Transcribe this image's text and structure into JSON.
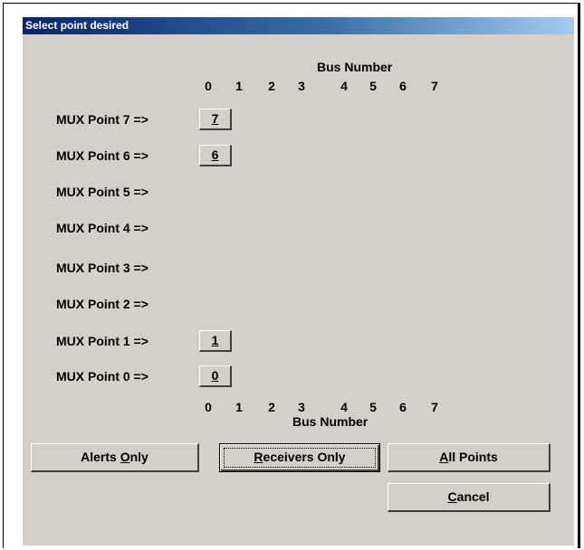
{
  "dialog": {
    "title": "Select point desired"
  },
  "bus_header_top": "Bus Number",
  "bus_header_bottom": "Bus Number",
  "bus_numbers": [
    "0",
    "1",
    "2",
    "3",
    "4",
    "5",
    "6",
    "7"
  ],
  "mux_rows": [
    {
      "label": "MUX Point 7 =>",
      "button": "7"
    },
    {
      "label": "MUX Point 6 =>",
      "button": "6"
    },
    {
      "label": "MUX Point 5 =>",
      "button": null
    },
    {
      "label": "MUX Point 4 =>",
      "button": null
    },
    {
      "label": "MUX Point 3 =>",
      "button": null
    },
    {
      "label": "MUX Point 2 =>",
      "button": null
    },
    {
      "label": "MUX Point 1 =>",
      "button": "1"
    },
    {
      "label": "MUX Point 0 =>",
      "button": "0"
    }
  ],
  "buttons": {
    "alerts_only": {
      "pre": "Alerts ",
      "accel": "O",
      "post": "nly"
    },
    "receivers_only": {
      "pre": "",
      "accel": "R",
      "post": "eceivers Only"
    },
    "all_points": {
      "pre": "",
      "accel": "A",
      "post": "ll Points"
    },
    "cancel": {
      "pre": "",
      "accel": "C",
      "post": "ancel"
    }
  }
}
